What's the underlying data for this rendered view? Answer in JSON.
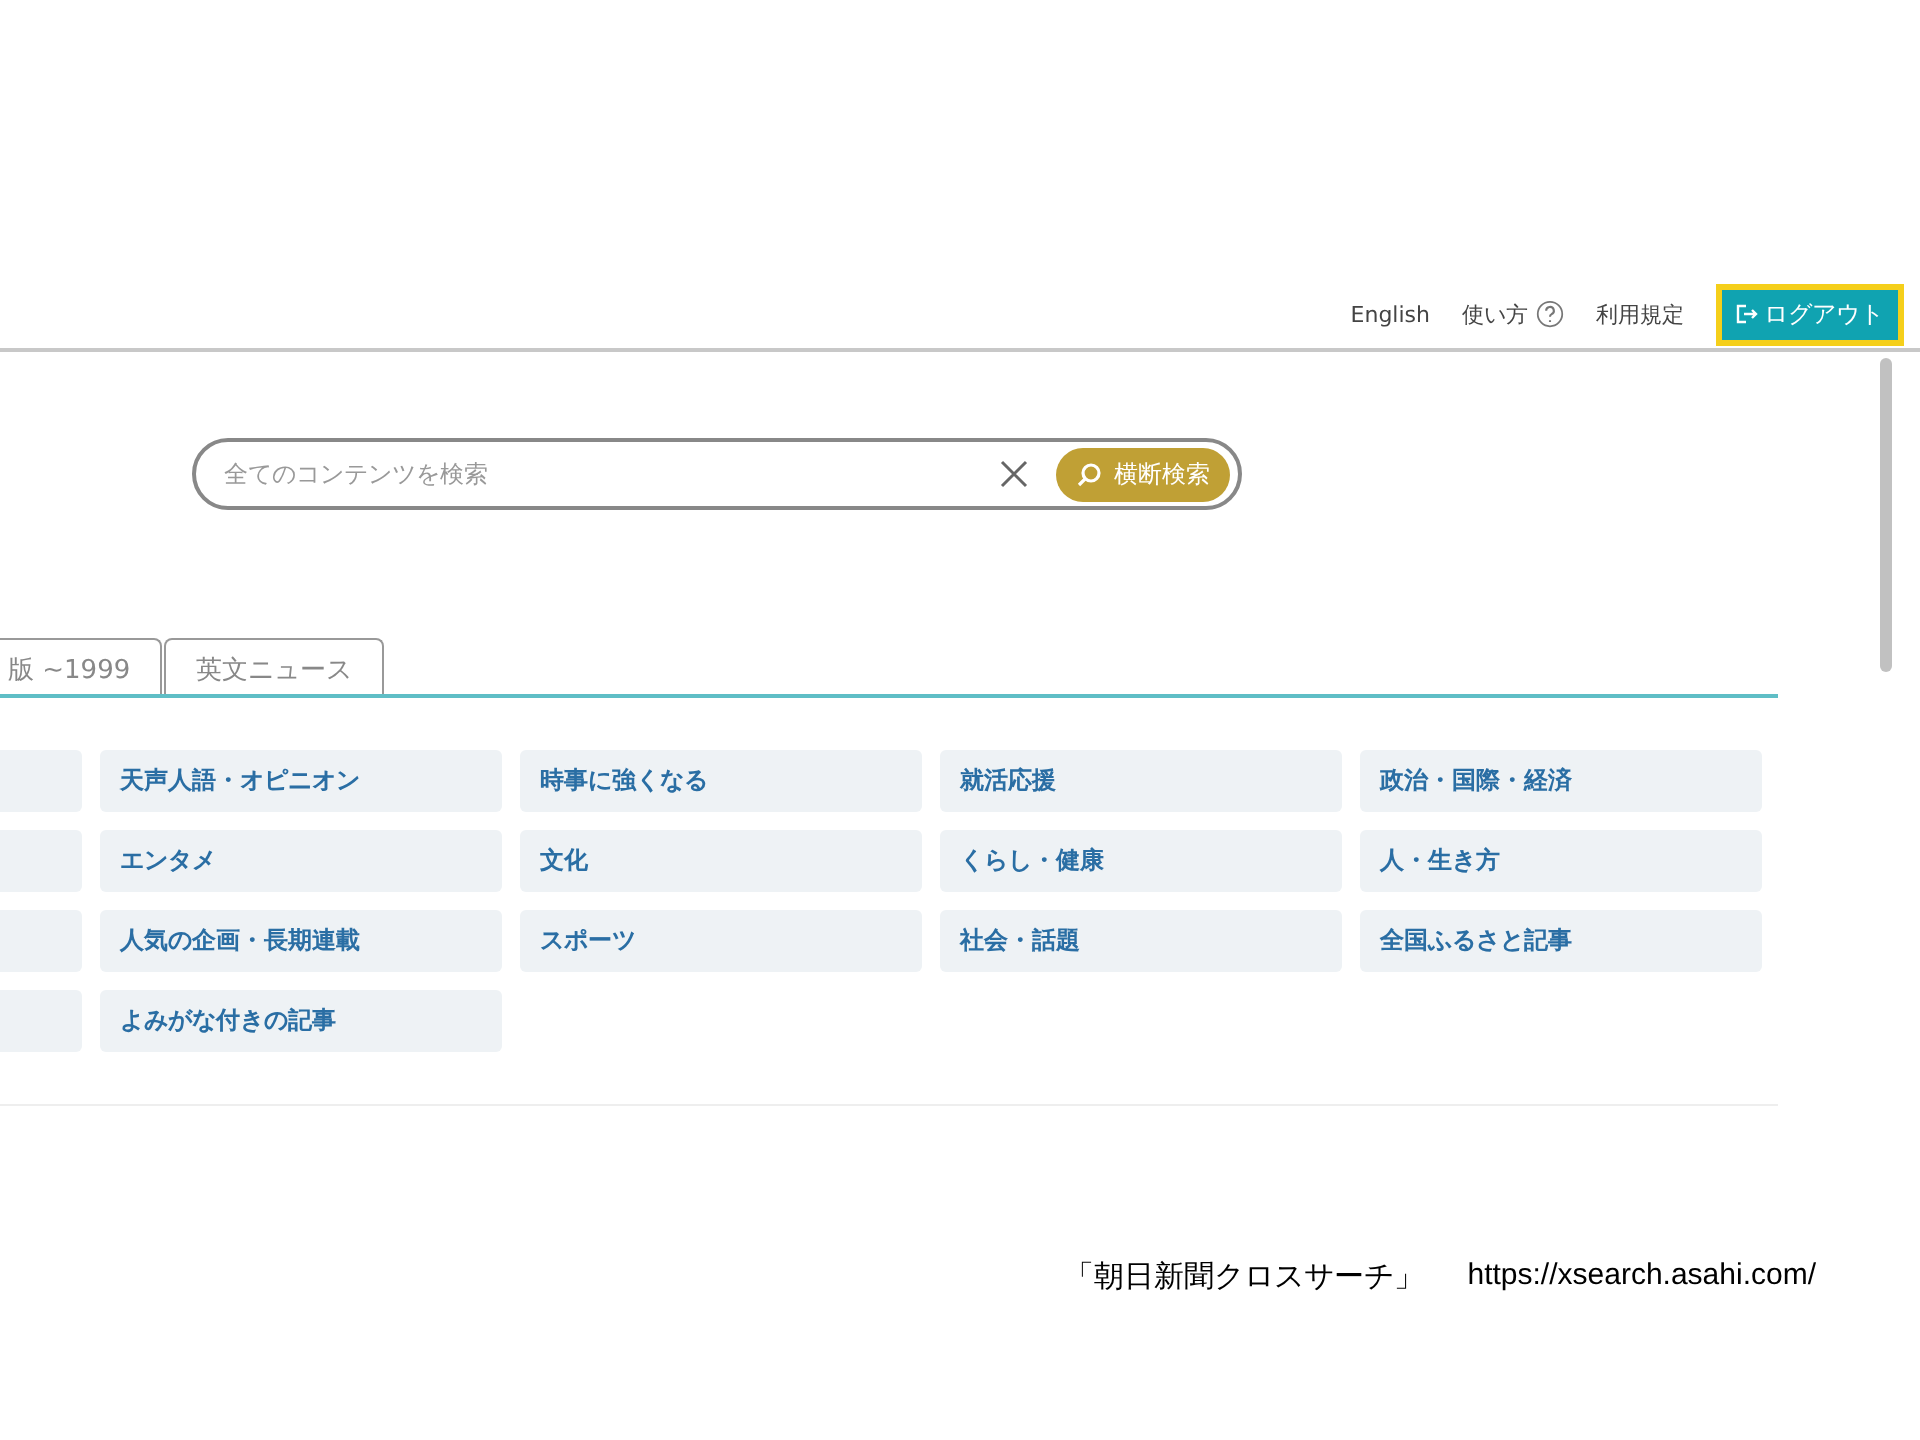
{
  "header": {
    "links": [
      {
        "label": "English",
        "kind": "text"
      },
      {
        "label": "使い方",
        "kind": "help"
      },
      {
        "label": "利用規定",
        "kind": "text"
      }
    ],
    "logout": {
      "label": "ログアウト",
      "highlighted": true
    }
  },
  "search": {
    "placeholder": "全てのコンテンツを検索",
    "button": "横断検索"
  },
  "tabs": [
    {
      "label": "版 ~1999",
      "selected": false
    },
    {
      "label": "英文ニュース",
      "selected": false
    }
  ],
  "categories": [
    [
      "天声人語・オピニオン",
      "時事に強くなる",
      "就活応援",
      "政治・国際・経済"
    ],
    [
      "エンタメ",
      "文化",
      "くらし・健康",
      "人・生き方"
    ],
    [
      "人気の企画・長期連載",
      "スポーツ",
      "社会・話題",
      "全国ふるさと記事"
    ],
    [
      "よみがな付きの記事"
    ]
  ],
  "caption": {
    "title": "「朝日新聞クロスサーチ」",
    "url": "https://xsearch.asahi.com/"
  }
}
